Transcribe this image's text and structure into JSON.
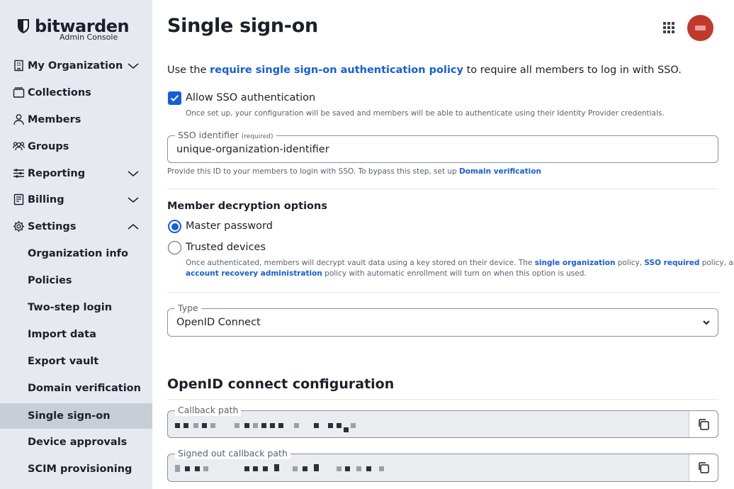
{
  "brand": {
    "name": "bitwarden",
    "subtitle": "Admin Console"
  },
  "sidebar": {
    "items": [
      {
        "label": "My Organization",
        "icon": "organization-icon",
        "expandable": true
      },
      {
        "label": "Collections",
        "icon": "collections-icon"
      },
      {
        "label": "Members",
        "icon": "members-icon"
      },
      {
        "label": "Groups",
        "icon": "groups-icon"
      },
      {
        "label": "Reporting",
        "icon": "reporting-icon",
        "expandable": true
      },
      {
        "label": "Billing",
        "icon": "billing-icon",
        "expandable": true
      },
      {
        "label": "Settings",
        "icon": "settings-icon",
        "expanded": true
      }
    ],
    "settings_children": [
      "Organization info",
      "Policies",
      "Two-step login",
      "Import data",
      "Export vault",
      "Domain verification",
      "Single sign-on",
      "Device approvals",
      "SCIM provisioning"
    ],
    "active": "Single sign-on"
  },
  "header": {
    "title": "Single sign-on"
  },
  "intro": {
    "prefix": "Use the ",
    "link": "require single sign-on authentication policy",
    "suffix": " to require all members to log in with SSO."
  },
  "allow_sso": {
    "checked": true,
    "label": "Allow SSO authentication",
    "hint": "Once set up, your configuration will be saved and members will be able to authenticate using their Identity Provider credentials."
  },
  "sso_identifier": {
    "label": "SSO identifier",
    "required": "(required)",
    "value": "unique-organization-identifier",
    "hint_prefix": "Provide this ID to your members to login with SSO. To bypass this step, set up ",
    "hint_link": "Domain verification"
  },
  "decryption": {
    "title": "Member decryption options",
    "selected": "Master password",
    "options": [
      "Master password",
      "Trusted devices"
    ],
    "hint_part1": "Once authenticated, members will decrypt vault data using a key stored on their device. The ",
    "hint_link1": "single organization",
    "hint_part2": " policy, ",
    "hint_link2": "SSO required",
    "hint_part3": " policy, and",
    "hint_link3": "account recovery administration",
    "hint_part4": " policy with automatic enrollment will turn on when this option is used."
  },
  "type_select": {
    "label": "Type",
    "value": "OpenID Connect"
  },
  "openid": {
    "title": "OpenID connect configuration",
    "callback_label": "Callback path",
    "signed_out_label": "Signed out callback path"
  },
  "colors": {
    "accent": "#175ddc",
    "sidebar_bg": "#e6e9ef",
    "active_bg": "#c8cdd6",
    "avatar": "#c0392b"
  }
}
